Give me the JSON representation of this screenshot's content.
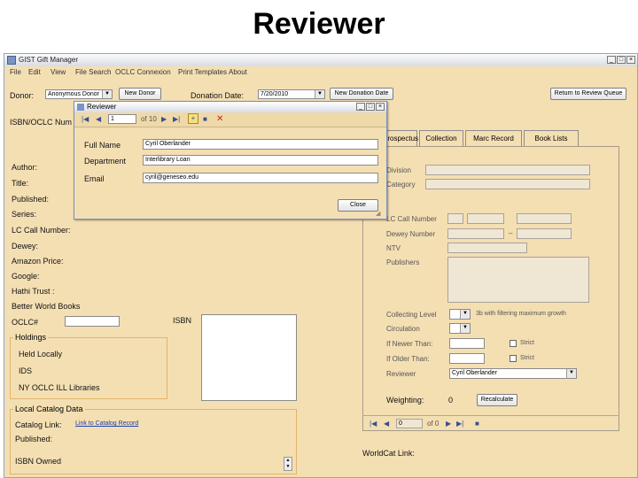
{
  "slide_title": "Reviewer",
  "app": {
    "window_title": "GIST Gift Manager",
    "menu": [
      "File",
      "Edit",
      "View",
      "File Search",
      "OCLC Connexion",
      "Print Templates",
      "About"
    ],
    "donor_label": "Donor:",
    "donor_value": "Anonymous Donor",
    "new_donor_label": "New Donor",
    "donation_date_label": "Donation Date:",
    "donation_date_value": "7/20/2010",
    "new_donation_date_label": "New Donation Date",
    "return_review_label": "Return to Review Queue",
    "isbn_oclc_label": "ISBN/OCLC Num",
    "tabs": [
      "Prospectus",
      "Collection",
      "Marc Record",
      "Book Lists"
    ],
    "left_fields": [
      "Author:",
      "Title:",
      "Published:",
      "Series:",
      "LC Call Number:",
      "Dewey:",
      "Amazon Price:",
      "Google:",
      "Hathi Trust :",
      "Better World Books"
    ],
    "oclc_label": "OCLC#",
    "isbn_label": "ISBN",
    "holdings": {
      "title": "Holdings",
      "items": [
        "Held Locally",
        "IDS",
        "NY OCLC ILL Libraries"
      ]
    },
    "local_catalog": {
      "title": "Local Catalog Data",
      "catalog_link_label": "Catalog Link:",
      "catalog_link_value": "Link to Catalog Record",
      "published_label": "Published:",
      "isbn_owned_label": "ISBN Owned"
    },
    "prospectus": {
      "division_label": "Division",
      "category_label": "Category",
      "lc_call_label": "LC Call Number",
      "dewey_label": "Dewey Number",
      "ntv_label": "NTV",
      "publishers_label": "Publishers",
      "collecting_level_label": "Collecting Level",
      "collecting_level_desc": "3b with filtering maximum growth",
      "circulation_label": "Circulation",
      "if_newer_label": "If Newer Than:",
      "if_older_label": "If Older Than:",
      "strict_label": "Strict",
      "reviewer_label": "Reviewer",
      "reviewer_value": "Cyril Oberlander",
      "weighting_label": "Weighting:",
      "weighting_value": "0",
      "recalculate_label": "Recalculate",
      "nav_position": "0",
      "nav_of": "of 0"
    },
    "worldcat_label": "WorldCat Link:"
  },
  "dialog": {
    "title": "Reviewer",
    "nav_position": "1",
    "nav_of": "of 10",
    "full_name_label": "Full Name",
    "full_name_value": "Cyril Oberlander",
    "department_label": "Department",
    "department_value": "Interlibrary Loan",
    "email_label": "Email",
    "email_value": "cyril@geneseo.edu",
    "close_label": "Close"
  }
}
